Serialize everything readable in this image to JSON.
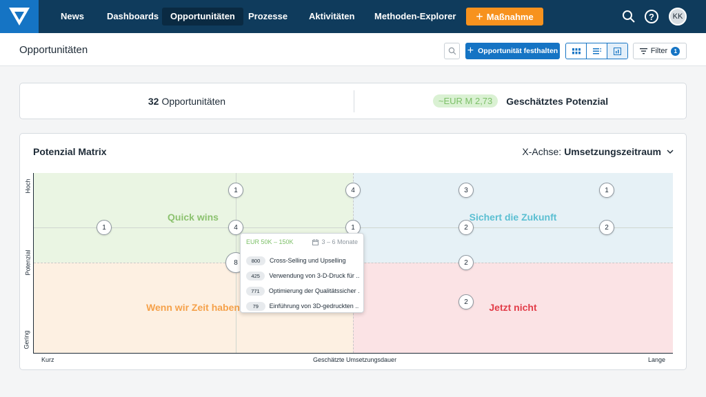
{
  "nav": {
    "items": [
      "News",
      "Dashboards",
      "Opportunitäten",
      "Prozesse",
      "Aktivitäten",
      "Methoden-Explorer"
    ],
    "active": "Opportunitäten",
    "action_label": "Maßnahme",
    "avatar_initials": "KK",
    "help_symbol": "?",
    "colors": {
      "bar": "#0f3b5c",
      "logo": "#1574c4",
      "action": "#f7921e"
    }
  },
  "header": {
    "title": "Opportunitäten",
    "add_label": "Opportunität festhalten",
    "filter_label": "Filter",
    "filter_count": "1"
  },
  "stats": {
    "count": "32",
    "count_label": "Opportunitäten",
    "potential_value": "~EUR M 2,73",
    "potential_label": "Geschätztes Potenzial"
  },
  "matrix": {
    "title": "Potenzial Matrix",
    "xaxis_prefix": "X-Achse:",
    "xaxis_value": "Umsetzungszeitraum",
    "y_axis_label": "Potenzial",
    "y_high": "Hoch",
    "y_low": "Gering",
    "x_axis_label": "Geschätzte Umsetzungsdauer",
    "x_short": "Kurz",
    "x_long": "Lange",
    "quadrants": {
      "top_left": "Quick wins",
      "top_right": "Sichert die Zukunft",
      "bottom_left": "Wenn wir Zeit haben",
      "bottom_right": "Jetzt nicht"
    },
    "bubbles": [
      "1",
      "4",
      "3",
      "1",
      "1",
      "4",
      "1",
      "2",
      "2",
      "8",
      "2",
      "2"
    ],
    "tooltip": {
      "range": "EUR 50K – 150K",
      "time": "3 – 6 Monate",
      "rows": [
        {
          "count": "800",
          "label": "Cross-Selling und Upselling"
        },
        {
          "count": "425",
          "label": "Verwendung von 3-D-Druck für ..."
        },
        {
          "count": "771",
          "label": "Optimierung der Qualitätssicher ..."
        },
        {
          "count": "79",
          "label": "Einführung von 3D-gedruckten ..."
        }
      ]
    },
    "colors": {
      "quick_wins": "#eaf5e3",
      "future": "#e6f1f6",
      "later": "#fdf0e2",
      "not_now": "#fbe3e5",
      "quick_wins_text": "#8cc26f",
      "future_text": "#5bbfd2",
      "later_text": "#f5a14a",
      "not_now_text": "#e23c48"
    }
  }
}
